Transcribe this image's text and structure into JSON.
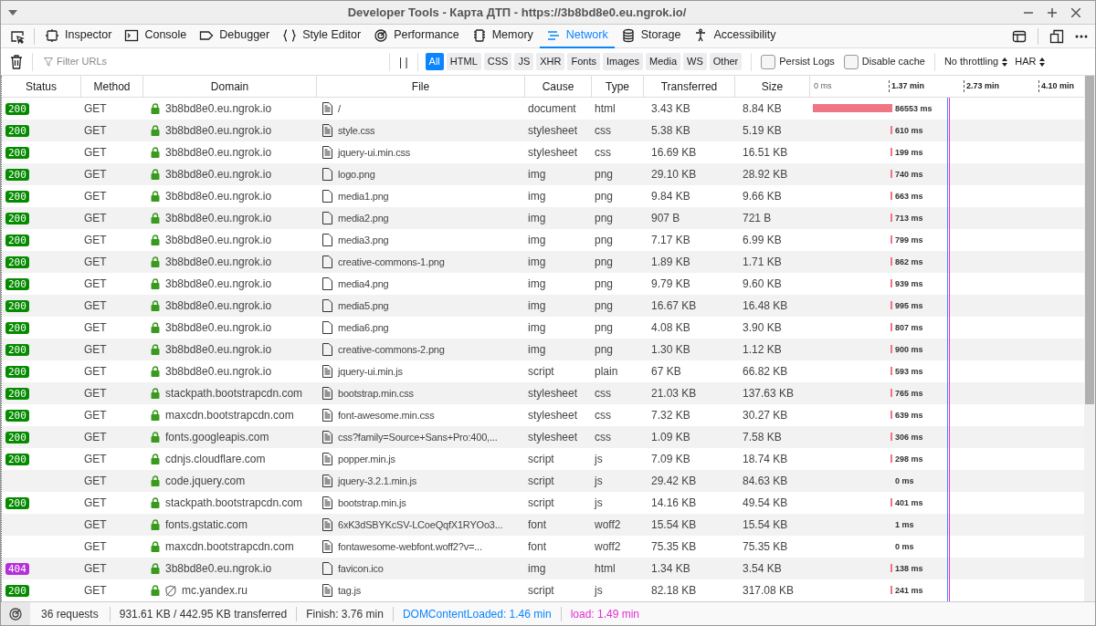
{
  "window": {
    "title": "Developer Tools - Карта ДТП - https://3b8bd8e0.eu.ngrok.io/"
  },
  "tools": [
    {
      "label": "Inspector",
      "selected": false
    },
    {
      "label": "Console",
      "selected": false
    },
    {
      "label": "Debugger",
      "selected": false
    },
    {
      "label": "Style Editor",
      "selected": false
    },
    {
      "label": "Performance",
      "selected": false
    },
    {
      "label": "Memory",
      "selected": false
    },
    {
      "label": "Network",
      "selected": true
    },
    {
      "label": "Storage",
      "selected": false
    },
    {
      "label": "Accessibility",
      "selected": false
    }
  ],
  "filter": {
    "placeholder": "Filter URLs",
    "pause": "| |"
  },
  "types": [
    {
      "label": "All",
      "selected": true
    },
    {
      "label": "HTML",
      "selected": false
    },
    {
      "label": "CSS",
      "selected": false
    },
    {
      "label": "JS",
      "selected": false
    },
    {
      "label": "XHR",
      "selected": false
    },
    {
      "label": "Fonts",
      "selected": false
    },
    {
      "label": "Images",
      "selected": false
    },
    {
      "label": "Media",
      "selected": false
    },
    {
      "label": "WS",
      "selected": false
    },
    {
      "label": "Other",
      "selected": false
    }
  ],
  "options": [
    {
      "label": "Persist Logs",
      "checked": false
    },
    {
      "label": "Disable cache",
      "checked": false
    }
  ],
  "throttling": "No throttling",
  "har": "HAR",
  "columns": [
    "Status",
    "Method",
    "Domain",
    "File",
    "Cause",
    "Type",
    "Transferred",
    "Size"
  ],
  "timeline_ticks": [
    "0 ms",
    "1.37 min",
    "2.73 min",
    "4.10 min"
  ],
  "rows": [
    {
      "status": "200",
      "color": "#058b00",
      "method": "GET",
      "domain": "3b8bd8e0.eu.ngrok.io",
      "tracker": false,
      "file": "/",
      "kind": "text",
      "cause": "document",
      "type": "html",
      "transferred": "3.43 KB",
      "size": "8.84 KB",
      "timing": {
        "kind": "long",
        "label": "86553 ms"
      }
    },
    {
      "status": "200",
      "color": "#058b00",
      "method": "GET",
      "domain": "3b8bd8e0.eu.ngrok.io",
      "tracker": false,
      "file": "style.css",
      "kind": "text",
      "cause": "stylesheet",
      "type": "css",
      "transferred": "5.38 KB",
      "size": "5.19 KB",
      "timing": {
        "kind": "short",
        "label": "610 ms"
      }
    },
    {
      "status": "200",
      "color": "#058b00",
      "method": "GET",
      "domain": "3b8bd8e0.eu.ngrok.io",
      "tracker": false,
      "file": "jquery-ui.min.css",
      "kind": "text",
      "cause": "stylesheet",
      "type": "css",
      "transferred": "16.69 KB",
      "size": "16.51 KB",
      "timing": {
        "kind": "short",
        "label": "199 ms"
      }
    },
    {
      "status": "200",
      "color": "#058b00",
      "method": "GET",
      "domain": "3b8bd8e0.eu.ngrok.io",
      "tracker": false,
      "file": "logo.png",
      "kind": "blank",
      "cause": "img",
      "type": "png",
      "transferred": "29.10 KB",
      "size": "28.92 KB",
      "timing": {
        "kind": "short",
        "label": "740 ms"
      }
    },
    {
      "status": "200",
      "color": "#058b00",
      "method": "GET",
      "domain": "3b8bd8e0.eu.ngrok.io",
      "tracker": false,
      "file": "media1.png",
      "kind": "blank",
      "cause": "img",
      "type": "png",
      "transferred": "9.84 KB",
      "size": "9.66 KB",
      "timing": {
        "kind": "short",
        "label": "663 ms"
      }
    },
    {
      "status": "200",
      "color": "#058b00",
      "method": "GET",
      "domain": "3b8bd8e0.eu.ngrok.io",
      "tracker": false,
      "file": "media2.png",
      "kind": "blank",
      "cause": "img",
      "type": "png",
      "transferred": "907 B",
      "size": "721 B",
      "timing": {
        "kind": "short",
        "label": "713 ms"
      }
    },
    {
      "status": "200",
      "color": "#058b00",
      "method": "GET",
      "domain": "3b8bd8e0.eu.ngrok.io",
      "tracker": false,
      "file": "media3.png",
      "kind": "blank",
      "cause": "img",
      "type": "png",
      "transferred": "7.17 KB",
      "size": "6.99 KB",
      "timing": {
        "kind": "short",
        "label": "799 ms"
      }
    },
    {
      "status": "200",
      "color": "#058b00",
      "method": "GET",
      "domain": "3b8bd8e0.eu.ngrok.io",
      "tracker": false,
      "file": "creative-commons-1.png",
      "kind": "blank",
      "cause": "img",
      "type": "png",
      "transferred": "1.89 KB",
      "size": "1.71 KB",
      "timing": {
        "kind": "short",
        "label": "862 ms"
      }
    },
    {
      "status": "200",
      "color": "#058b00",
      "method": "GET",
      "domain": "3b8bd8e0.eu.ngrok.io",
      "tracker": false,
      "file": "media4.png",
      "kind": "blank",
      "cause": "img",
      "type": "png",
      "transferred": "9.79 KB",
      "size": "9.60 KB",
      "timing": {
        "kind": "short",
        "label": "939 ms"
      }
    },
    {
      "status": "200",
      "color": "#058b00",
      "method": "GET",
      "domain": "3b8bd8e0.eu.ngrok.io",
      "tracker": false,
      "file": "media5.png",
      "kind": "blank",
      "cause": "img",
      "type": "png",
      "transferred": "16.67 KB",
      "size": "16.48 KB",
      "timing": {
        "kind": "short",
        "label": "995 ms"
      }
    },
    {
      "status": "200",
      "color": "#058b00",
      "method": "GET",
      "domain": "3b8bd8e0.eu.ngrok.io",
      "tracker": false,
      "file": "media6.png",
      "kind": "blank",
      "cause": "img",
      "type": "png",
      "transferred": "4.08 KB",
      "size": "3.90 KB",
      "timing": {
        "kind": "short",
        "label": "807 ms"
      }
    },
    {
      "status": "200",
      "color": "#058b00",
      "method": "GET",
      "domain": "3b8bd8e0.eu.ngrok.io",
      "tracker": false,
      "file": "creative-commons-2.png",
      "kind": "blank",
      "cause": "img",
      "type": "png",
      "transferred": "1.30 KB",
      "size": "1.12 KB",
      "timing": {
        "kind": "short",
        "label": "900 ms"
      }
    },
    {
      "status": "200",
      "color": "#058b00",
      "method": "GET",
      "domain": "3b8bd8e0.eu.ngrok.io",
      "tracker": false,
      "file": "jquery-ui.min.js",
      "kind": "text",
      "cause": "script",
      "type": "plain",
      "transferred": "67 KB",
      "size": "66.82 KB",
      "timing": {
        "kind": "short",
        "label": "593 ms"
      }
    },
    {
      "status": "200",
      "color": "#058b00",
      "method": "GET",
      "domain": "stackpath.bootstrapcdn.com",
      "tracker": false,
      "file": "bootstrap.min.css",
      "kind": "text",
      "cause": "stylesheet",
      "type": "css",
      "transferred": "21.03 KB",
      "size": "137.63 KB",
      "timing": {
        "kind": "short",
        "label": "765 ms"
      }
    },
    {
      "status": "200",
      "color": "#058b00",
      "method": "GET",
      "domain": "maxcdn.bootstrapcdn.com",
      "tracker": false,
      "file": "font-awesome.min.css",
      "kind": "text",
      "cause": "stylesheet",
      "type": "css",
      "transferred": "7.32 KB",
      "size": "30.27 KB",
      "timing": {
        "kind": "short",
        "label": "639 ms"
      }
    },
    {
      "status": "200",
      "color": "#058b00",
      "method": "GET",
      "domain": "fonts.googleapis.com",
      "tracker": false,
      "file": "css?family=Source+Sans+Pro:400,...",
      "kind": "text",
      "cause": "stylesheet",
      "type": "css",
      "transferred": "1.09 KB",
      "size": "7.58 KB",
      "timing": {
        "kind": "short",
        "label": "306 ms"
      }
    },
    {
      "status": "200",
      "color": "#058b00",
      "method": "GET",
      "domain": "cdnjs.cloudflare.com",
      "tracker": false,
      "file": "popper.min.js",
      "kind": "text",
      "cause": "script",
      "type": "js",
      "transferred": "7.09 KB",
      "size": "18.74 KB",
      "timing": {
        "kind": "short",
        "label": "298 ms"
      }
    },
    {
      "method": "GET",
      "domain": "code.jquery.com",
      "tracker": false,
      "file": "jquery-3.2.1.min.js",
      "kind": "text",
      "cause": "script",
      "type": "js",
      "transferred": "29.42 KB",
      "size": "84.63 KB",
      "timing": {
        "kind": "none",
        "label": "0 ms"
      }
    },
    {
      "status": "200",
      "color": "#058b00",
      "method": "GET",
      "domain": "stackpath.bootstrapcdn.com",
      "tracker": false,
      "file": "bootstrap.min.js",
      "kind": "text",
      "cause": "script",
      "type": "js",
      "transferred": "14.16 KB",
      "size": "49.54 KB",
      "timing": {
        "kind": "short",
        "label": "401 ms"
      }
    },
    {
      "method": "GET",
      "domain": "fonts.gstatic.com",
      "tracker": false,
      "file": "6xK3dSBYKcSV-LCoeQqfX1RYOo3...",
      "kind": "text",
      "cause": "font",
      "type": "woff2",
      "transferred": "15.54 KB",
      "size": "15.54 KB",
      "timing": {
        "kind": "none",
        "label": "1 ms"
      }
    },
    {
      "method": "GET",
      "domain": "maxcdn.bootstrapcdn.com",
      "tracker": false,
      "file": "fontawesome-webfont.woff2?v=...",
      "kind": "text",
      "cause": "font",
      "type": "woff2",
      "transferred": "75.35 KB",
      "size": "75.35 KB",
      "timing": {
        "kind": "none",
        "label": "0 ms"
      }
    },
    {
      "status": "404",
      "color": "#b42fd9",
      "method": "GET",
      "domain": "3b8bd8e0.eu.ngrok.io",
      "tracker": false,
      "file": "favicon.ico",
      "kind": "blank",
      "cause": "img",
      "type": "html",
      "transferred": "1.34 KB",
      "size": "3.54 KB",
      "timing": {
        "kind": "short",
        "label": "138 ms"
      }
    },
    {
      "status": "200",
      "color": "#058b00",
      "method": "GET",
      "domain": "mc.yandex.ru",
      "tracker": true,
      "file": "tag.js",
      "kind": "text",
      "cause": "script",
      "type": "js",
      "transferred": "82.18 KB",
      "size": "317.08 KB",
      "timing": {
        "kind": "short",
        "label": "241 ms"
      }
    }
  ],
  "status_bar": {
    "requests": "36 requests",
    "transferred": "931.61 KB / 442.95 KB transferred",
    "finish": "Finish: 3.76 min",
    "dom": "DOMContentLoaded: 1.46 min",
    "load": "load: 1.49 min"
  }
}
